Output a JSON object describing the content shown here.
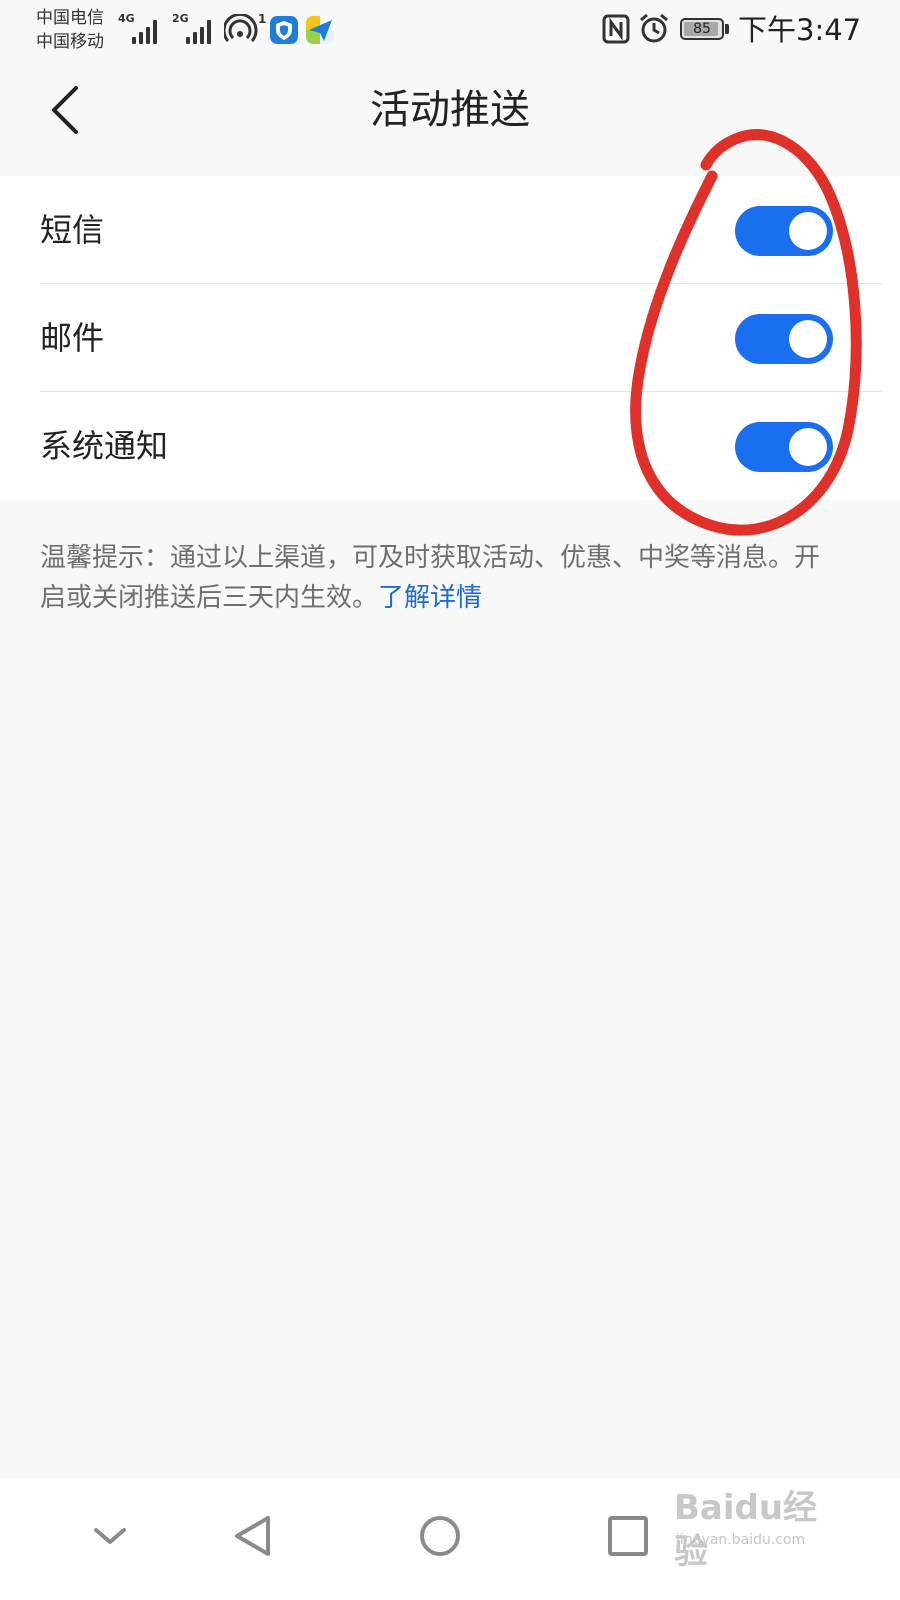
{
  "status_bar": {
    "carrier_1": "中国电信",
    "carrier_2": "中国移动",
    "network_1": "4G",
    "network_2": "2G",
    "hotspot_count": "1",
    "battery_level": "85",
    "time": "下午3:47",
    "icons": [
      "signal-icon",
      "hotspot-icon",
      "shield-app-icon",
      "plane-app-icon",
      "nfc-icon",
      "alarm-icon",
      "battery-icon"
    ]
  },
  "header": {
    "title": "活动推送",
    "back_icon": "chevron-left-icon"
  },
  "settings": {
    "items": [
      {
        "label": "短信",
        "enabled": true
      },
      {
        "label": "邮件",
        "enabled": true
      },
      {
        "label": "系统通知",
        "enabled": true
      }
    ]
  },
  "tip": {
    "text": "温馨提示：通过以上渠道，可及时获取活动、优惠、中奖等消息。开启或关闭推送后三天内生效。",
    "link_text": "了解详情"
  },
  "nav_bar": {
    "icons": [
      "chevron-down-icon",
      "back-triangle-icon",
      "home-circle-icon",
      "recents-square-icon"
    ]
  },
  "colors": {
    "toggle_on": "#1a6ff0",
    "link": "#1b6ad6",
    "annotation": "#e0302a",
    "background": "#f8f8f8"
  },
  "watermark": {
    "brand": "Baidu经验",
    "sub": "jingyan.baidu.com"
  }
}
